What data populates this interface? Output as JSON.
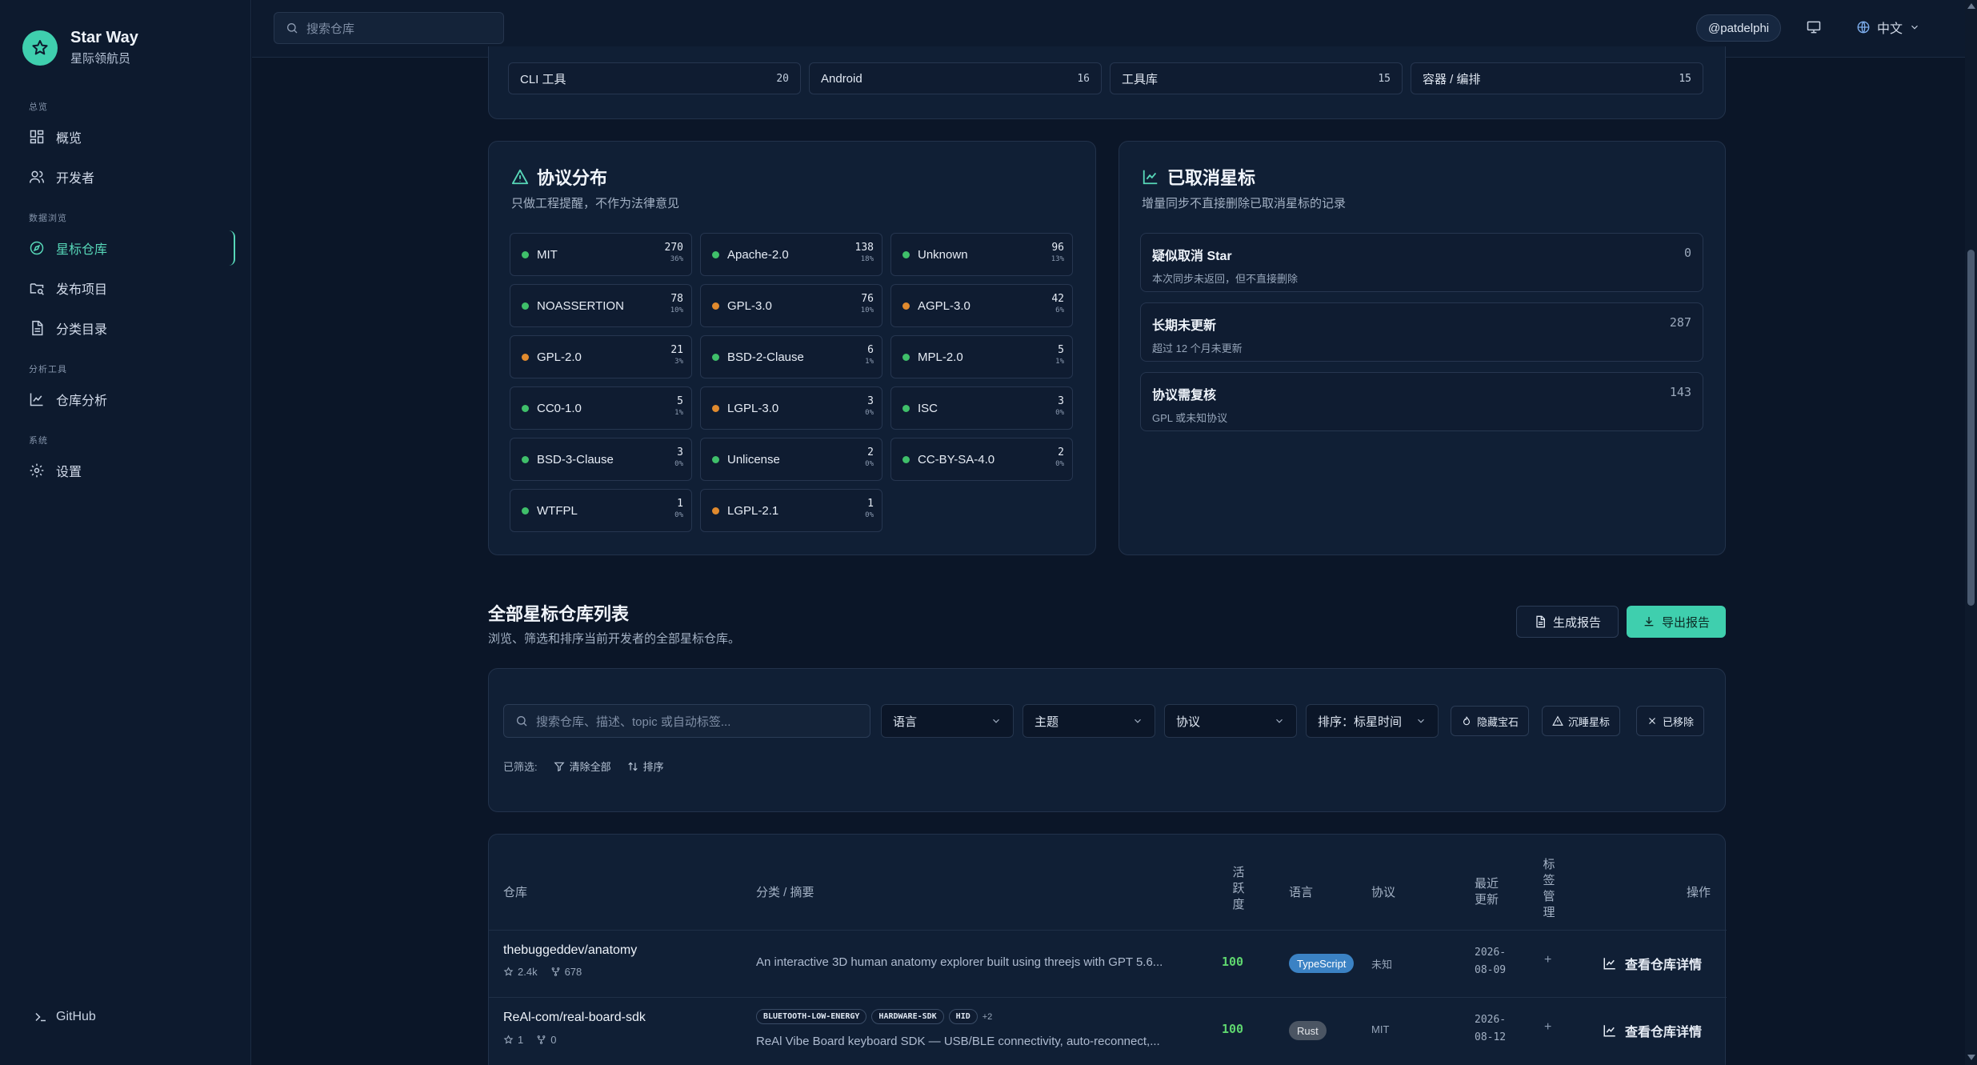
{
  "brand": {
    "title": "Star Way",
    "subtitle": "星际领航员"
  },
  "sidebar": {
    "sections": [
      {
        "label": "总览",
        "items": [
          {
            "label": "概览"
          },
          {
            "label": "开发者"
          }
        ]
      },
      {
        "label": "数据浏览",
        "items": [
          {
            "label": "星标仓库"
          },
          {
            "label": "发布项目"
          },
          {
            "label": "分类目录"
          }
        ]
      },
      {
        "label": "分析工具",
        "items": [
          {
            "label": "仓库分析"
          }
        ]
      },
      {
        "label": "系统",
        "items": [
          {
            "label": "设置"
          }
        ]
      }
    ],
    "github_label": "GitHub"
  },
  "topbar": {
    "search_placeholder": "搜索仓库",
    "user": "@patdelphi",
    "language": "中文"
  },
  "categories": [
    {
      "name": "CLI 工具",
      "count": "20"
    },
    {
      "name": "Android",
      "count": "16"
    },
    {
      "name": "工具库",
      "count": "15"
    },
    {
      "name": "容器 / 编排",
      "count": "15"
    }
  ],
  "licenses": {
    "title": "协议分布",
    "subtitle": "只做工程提醒，不作为法律意见",
    "items": [
      {
        "name": "MIT",
        "count": "270",
        "pct": "36%",
        "color": "#3fbf6a"
      },
      {
        "name": "Apache-2.0",
        "count": "138",
        "pct": "18%",
        "color": "#3fbf6a"
      },
      {
        "name": "Unknown",
        "count": "96",
        "pct": "13%",
        "color": "#3fbf6a"
      },
      {
        "name": "NOASSERTION",
        "count": "78",
        "pct": "10%",
        "color": "#3fbf6a"
      },
      {
        "name": "GPL-3.0",
        "count": "76",
        "pct": "10%",
        "color": "#e08a2e"
      },
      {
        "name": "AGPL-3.0",
        "count": "42",
        "pct": "6%",
        "color": "#e08a2e"
      },
      {
        "name": "GPL-2.0",
        "count": "21",
        "pct": "3%",
        "color": "#e08a2e"
      },
      {
        "name": "BSD-2-Clause",
        "count": "6",
        "pct": "1%",
        "color": "#3fbf6a"
      },
      {
        "name": "MPL-2.0",
        "count": "5",
        "pct": "1%",
        "color": "#3fbf6a"
      },
      {
        "name": "CC0-1.0",
        "count": "5",
        "pct": "1%",
        "color": "#3fbf6a"
      },
      {
        "name": "LGPL-3.0",
        "count": "3",
        "pct": "0%",
        "color": "#e08a2e"
      },
      {
        "name": "ISC",
        "count": "3",
        "pct": "0%",
        "color": "#3fbf6a"
      },
      {
        "name": "BSD-3-Clause",
        "count": "3",
        "pct": "0%",
        "color": "#3fbf6a"
      },
      {
        "name": "Unlicense",
        "count": "2",
        "pct": "0%",
        "color": "#3fbf6a"
      },
      {
        "name": "CC-BY-SA-4.0",
        "count": "2",
        "pct": "0%",
        "color": "#3fbf6a"
      },
      {
        "name": "WTFPL",
        "count": "1",
        "pct": "0%",
        "color": "#3fbf6a"
      },
      {
        "name": "LGPL-2.1",
        "count": "1",
        "pct": "0%",
        "color": "#e08a2e"
      }
    ]
  },
  "unstarred": {
    "title": "已取消星标",
    "subtitle": "增量同步不直接删除已取消星标的记录",
    "items": [
      {
        "title": "疑似取消 Star",
        "desc": "本次同步未返回，但不直接删除",
        "value": "0"
      },
      {
        "title": "长期未更新",
        "desc": "超过 12 个月未更新",
        "value": "287"
      },
      {
        "title": "协议需复核",
        "desc": "GPL 或未知协议",
        "value": "143"
      }
    ]
  },
  "list_section": {
    "title": "全部星标仓库列表",
    "subtitle": "浏览、筛选和排序当前开发者的全部星标仓库。",
    "report_btn": "生成报告",
    "export_btn": "导出报告"
  },
  "filters": {
    "search_placeholder": "搜索仓库、描述、topic 或自动标签...",
    "language": "语言",
    "topic": "主题",
    "license": "协议",
    "sort": "排序：标星时间",
    "hidden_gems": "隐藏宝石",
    "sunk_stars": "沉睡星标",
    "removed": "已移除",
    "selected_label": "已筛选:",
    "clear_all": "清除全部",
    "sort_btn": "排序"
  },
  "table": {
    "headers": {
      "repo": "仓库",
      "summary": "分类 / 摘要",
      "activity": "活跃度",
      "language": "语言",
      "license": "协议",
      "updated": "最近更新",
      "tags": "标签管理",
      "actions": "操作"
    },
    "rows": [
      {
        "name": "thebuggeddev/anatomy",
        "stars": "2.4k",
        "forks": "678",
        "topics": [],
        "summary": "An interactive 3D human anatomy explorer built using threejs with GPT 5.6...",
        "activity": "100",
        "language": "TypeScript",
        "lang_bg": "#3b82c4",
        "lang_fg": "#ffffff",
        "license": "未知",
        "date_line1": "2026-",
        "date_line2": "08-09",
        "detail": "查看仓库详情"
      },
      {
        "name": "ReAl-com/real-board-sdk",
        "stars": "1",
        "forks": "0",
        "topics": [
          "BLUETOOTH-LOW-ENERGY",
          "HARDWARE-SDK",
          "HID"
        ],
        "topics_more": "+2",
        "summary": "ReAl Vibe Board keyboard SDK — USB/BLE connectivity, auto-reconnect,...",
        "activity": "100",
        "language": "Rust",
        "lang_bg": "#4b5563",
        "lang_fg": "#e5e7eb",
        "license": "MIT",
        "date_line1": "2026-",
        "date_line2": "08-12",
        "detail": "查看仓库详情"
      }
    ]
  }
}
